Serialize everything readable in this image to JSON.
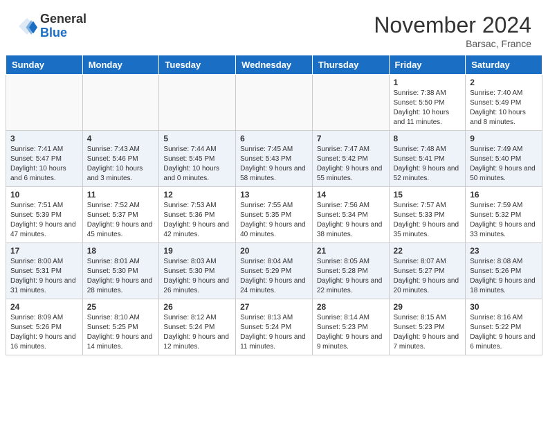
{
  "logo": {
    "general": "General",
    "blue": "Blue"
  },
  "title": "November 2024",
  "location": "Barsac, France",
  "days_of_week": [
    "Sunday",
    "Monday",
    "Tuesday",
    "Wednesday",
    "Thursday",
    "Friday",
    "Saturday"
  ],
  "weeks": [
    [
      {
        "day": "",
        "info": ""
      },
      {
        "day": "",
        "info": ""
      },
      {
        "day": "",
        "info": ""
      },
      {
        "day": "",
        "info": ""
      },
      {
        "day": "",
        "info": ""
      },
      {
        "day": "1",
        "info": "Sunrise: 7:38 AM\nSunset: 5:50 PM\nDaylight: 10 hours and 11 minutes."
      },
      {
        "day": "2",
        "info": "Sunrise: 7:40 AM\nSunset: 5:49 PM\nDaylight: 10 hours and 8 minutes."
      }
    ],
    [
      {
        "day": "3",
        "info": "Sunrise: 7:41 AM\nSunset: 5:47 PM\nDaylight: 10 hours and 6 minutes."
      },
      {
        "day": "4",
        "info": "Sunrise: 7:43 AM\nSunset: 5:46 PM\nDaylight: 10 hours and 3 minutes."
      },
      {
        "day": "5",
        "info": "Sunrise: 7:44 AM\nSunset: 5:45 PM\nDaylight: 10 hours and 0 minutes."
      },
      {
        "day": "6",
        "info": "Sunrise: 7:45 AM\nSunset: 5:43 PM\nDaylight: 9 hours and 58 minutes."
      },
      {
        "day": "7",
        "info": "Sunrise: 7:47 AM\nSunset: 5:42 PM\nDaylight: 9 hours and 55 minutes."
      },
      {
        "day": "8",
        "info": "Sunrise: 7:48 AM\nSunset: 5:41 PM\nDaylight: 9 hours and 52 minutes."
      },
      {
        "day": "9",
        "info": "Sunrise: 7:49 AM\nSunset: 5:40 PM\nDaylight: 9 hours and 50 minutes."
      }
    ],
    [
      {
        "day": "10",
        "info": "Sunrise: 7:51 AM\nSunset: 5:39 PM\nDaylight: 9 hours and 47 minutes."
      },
      {
        "day": "11",
        "info": "Sunrise: 7:52 AM\nSunset: 5:37 PM\nDaylight: 9 hours and 45 minutes."
      },
      {
        "day": "12",
        "info": "Sunrise: 7:53 AM\nSunset: 5:36 PM\nDaylight: 9 hours and 42 minutes."
      },
      {
        "day": "13",
        "info": "Sunrise: 7:55 AM\nSunset: 5:35 PM\nDaylight: 9 hours and 40 minutes."
      },
      {
        "day": "14",
        "info": "Sunrise: 7:56 AM\nSunset: 5:34 PM\nDaylight: 9 hours and 38 minutes."
      },
      {
        "day": "15",
        "info": "Sunrise: 7:57 AM\nSunset: 5:33 PM\nDaylight: 9 hours and 35 minutes."
      },
      {
        "day": "16",
        "info": "Sunrise: 7:59 AM\nSunset: 5:32 PM\nDaylight: 9 hours and 33 minutes."
      }
    ],
    [
      {
        "day": "17",
        "info": "Sunrise: 8:00 AM\nSunset: 5:31 PM\nDaylight: 9 hours and 31 minutes."
      },
      {
        "day": "18",
        "info": "Sunrise: 8:01 AM\nSunset: 5:30 PM\nDaylight: 9 hours and 28 minutes."
      },
      {
        "day": "19",
        "info": "Sunrise: 8:03 AM\nSunset: 5:30 PM\nDaylight: 9 hours and 26 minutes."
      },
      {
        "day": "20",
        "info": "Sunrise: 8:04 AM\nSunset: 5:29 PM\nDaylight: 9 hours and 24 minutes."
      },
      {
        "day": "21",
        "info": "Sunrise: 8:05 AM\nSunset: 5:28 PM\nDaylight: 9 hours and 22 minutes."
      },
      {
        "day": "22",
        "info": "Sunrise: 8:07 AM\nSunset: 5:27 PM\nDaylight: 9 hours and 20 minutes."
      },
      {
        "day": "23",
        "info": "Sunrise: 8:08 AM\nSunset: 5:26 PM\nDaylight: 9 hours and 18 minutes."
      }
    ],
    [
      {
        "day": "24",
        "info": "Sunrise: 8:09 AM\nSunset: 5:26 PM\nDaylight: 9 hours and 16 minutes."
      },
      {
        "day": "25",
        "info": "Sunrise: 8:10 AM\nSunset: 5:25 PM\nDaylight: 9 hours and 14 minutes."
      },
      {
        "day": "26",
        "info": "Sunrise: 8:12 AM\nSunset: 5:24 PM\nDaylight: 9 hours and 12 minutes."
      },
      {
        "day": "27",
        "info": "Sunrise: 8:13 AM\nSunset: 5:24 PM\nDaylight: 9 hours and 11 minutes."
      },
      {
        "day": "28",
        "info": "Sunrise: 8:14 AM\nSunset: 5:23 PM\nDaylight: 9 hours and 9 minutes."
      },
      {
        "day": "29",
        "info": "Sunrise: 8:15 AM\nSunset: 5:23 PM\nDaylight: 9 hours and 7 minutes."
      },
      {
        "day": "30",
        "info": "Sunrise: 8:16 AM\nSunset: 5:22 PM\nDaylight: 9 hours and 6 minutes."
      }
    ]
  ]
}
